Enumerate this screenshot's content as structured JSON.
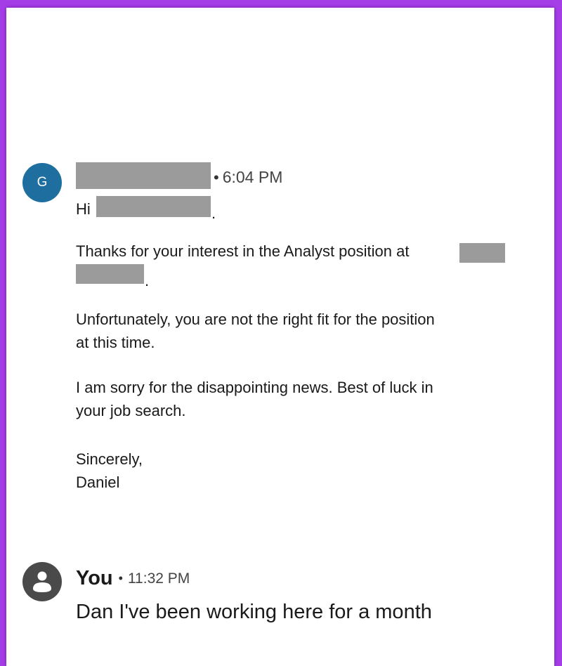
{
  "first_message": {
    "avatar_letter": "G",
    "time": "6:04 PM",
    "separator": "•",
    "greeting": "Hi",
    "greeting_end": ".",
    "para1": "Thanks for your interest in the Analyst position at",
    "para1_end": ".",
    "para2_line1": "Unfortunately, you are not the right fit for the position",
    "para2_line2": "at this time.",
    "para3_line1": "I am sorry for the disappointing news. Best of luck in",
    "para3_line2": "your job search.",
    "sign_off": "Sincerely,",
    "signature": "Daniel"
  },
  "reply": {
    "sender": "You",
    "separator": "•",
    "time": "11:32 PM",
    "text": "Dan I've been working here for a month"
  },
  "colors": {
    "border": "#a63ee8",
    "avatar_g": "#1f6ea0",
    "avatar_you": "#4a4a4a",
    "redaction": "#9b9b9b"
  }
}
